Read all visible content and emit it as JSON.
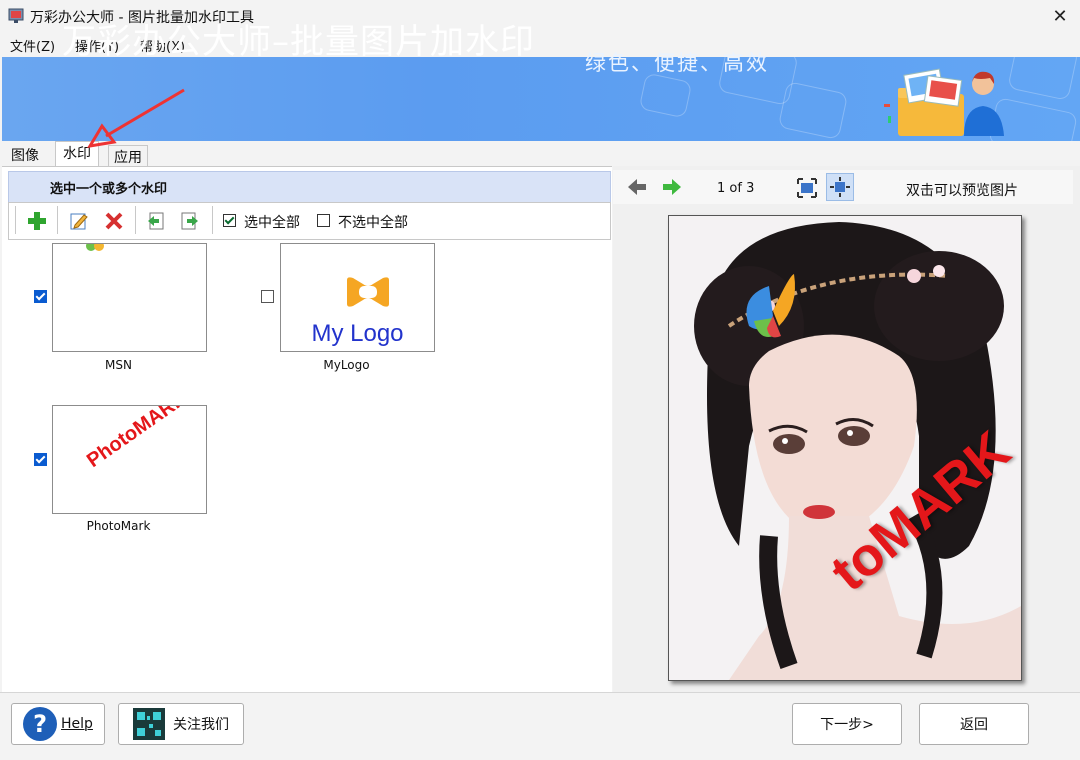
{
  "window": {
    "title": "万彩办公大师 - 图片批量加水印工具",
    "close_glyph": "✕"
  },
  "menu": [
    {
      "label": "文件(Z)"
    },
    {
      "label": "操作(Y)"
    },
    {
      "label": "帮助(X)"
    }
  ],
  "banner": {
    "title": "万彩办公大师–批量图片加水印",
    "slogan": "绿色、便捷、高效"
  },
  "tabs": [
    {
      "label": "图像"
    },
    {
      "label": "水印",
      "active": true
    },
    {
      "label": "应用"
    }
  ],
  "watermark_panel": {
    "header": "选中一个或多个水印",
    "toolbar": {
      "icons": [
        "add-icon",
        "edit-icon",
        "delete-icon",
        "import-icon",
        "export-icon"
      ],
      "select_all": "选中全部",
      "select_all_checked": true,
      "deselect_all": "不选中全部",
      "deselect_all_checked": false
    },
    "items": [
      {
        "name": "MSN",
        "checked": true
      },
      {
        "name": "MyLogo",
        "checked": false,
        "preview_text": "My Logo"
      },
      {
        "name": "PhotoMark",
        "checked": true,
        "preview_text": "PhotoMARK"
      }
    ]
  },
  "preview": {
    "page_indicator": "1 of 3",
    "hint": "双击可以预览图片",
    "watermark_text": "toMARK"
  },
  "bottom": {
    "help": "Help",
    "follow": "关注我们",
    "next": "下一步>",
    "back": "返回"
  },
  "colors": {
    "banner": "#5b9cf0",
    "accent": "#0a5bd0",
    "watermark_red": "#e4171a"
  }
}
